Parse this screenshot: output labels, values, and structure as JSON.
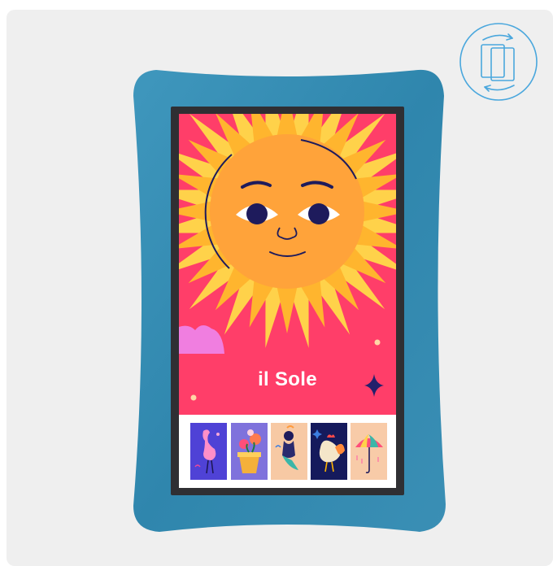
{
  "rotate_button": {
    "icon": "rotate-device-icon",
    "color": "#4aa7dd"
  },
  "kiosk": {
    "frame_color": "#3a8eb0",
    "bezel_color": "#2f2f33"
  },
  "screen": {
    "title": "il Sole",
    "background": "#ff3e69",
    "thumbnails": [
      {
        "name": "flamingo",
        "background": "#4f42d6",
        "icon": "flamingo-icon"
      },
      {
        "name": "flower-pot",
        "background": "#7f72dc",
        "icon": "flower-pot-icon"
      },
      {
        "name": "mermaid",
        "background": "#f7c9a4",
        "icon": "mermaid-icon"
      },
      {
        "name": "rooster",
        "background": "#151a5c",
        "icon": "rooster-icon"
      },
      {
        "name": "umbrella",
        "background": "#f8cba8",
        "icon": "umbrella-icon"
      }
    ]
  }
}
